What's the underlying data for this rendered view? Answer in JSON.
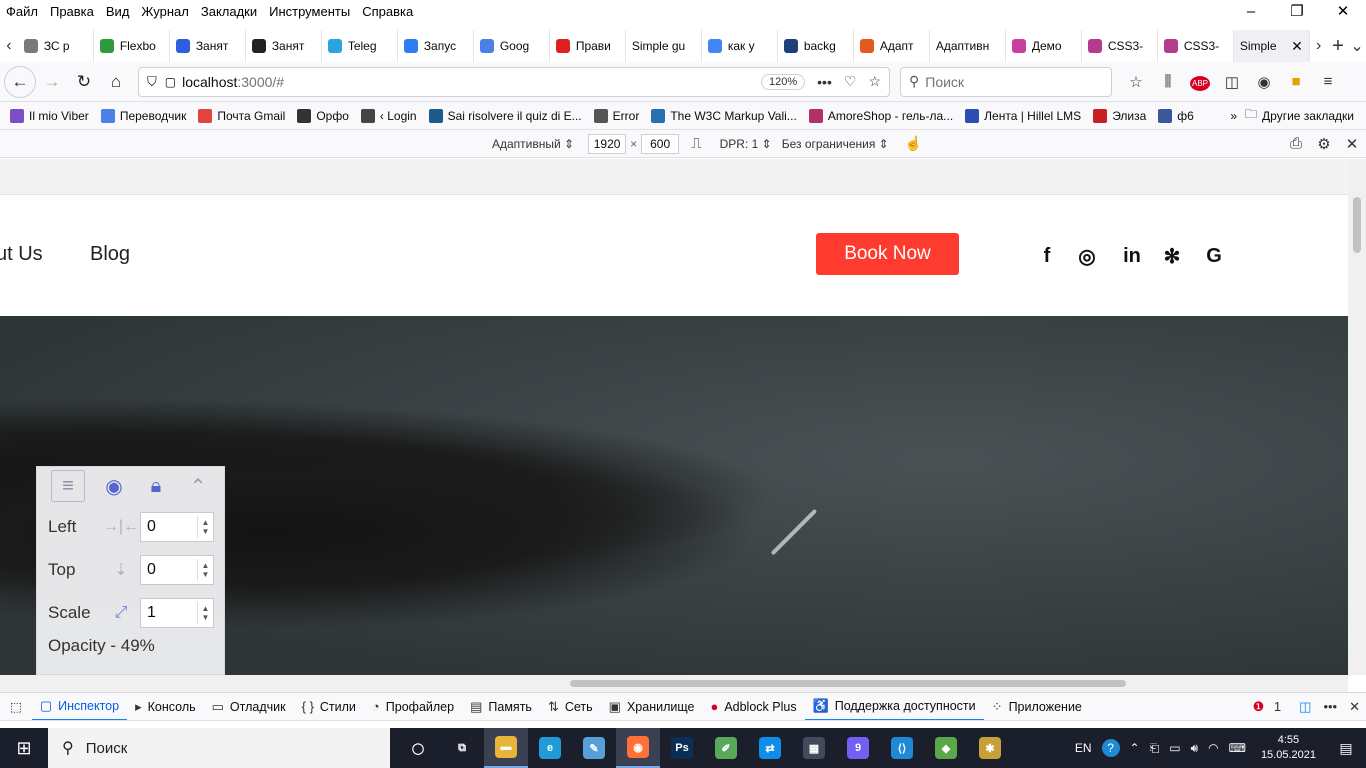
{
  "menubar": {
    "items": [
      "Файл",
      "Правка",
      "Вид",
      "Журнал",
      "Закладки",
      "Инструменты",
      "Справка"
    ]
  },
  "tabs": [
    {
      "label": "ЗС р",
      "color": "#7a7a7a"
    },
    {
      "label": "Flexbo",
      "color": "#2e9b3d"
    },
    {
      "label": "Занят",
      "color": "#2d5ee0"
    },
    {
      "label": "Занят",
      "color": "#222222"
    },
    {
      "label": "Teleg",
      "color": "#2aa3e0"
    },
    {
      "label": "Запус",
      "color": "#2d7cf6"
    },
    {
      "label": "Goog",
      "color": "#4a80e8"
    },
    {
      "label": "Прави",
      "color": "#e02020"
    },
    {
      "label": "Simple gu",
      "color": ""
    },
    {
      "label": "как у",
      "color": "#4285f4"
    },
    {
      "label": "backg",
      "color": "#1f3f7a"
    },
    {
      "label": "Адапт",
      "color": "#e25a1c"
    },
    {
      "label": "Адаптивн",
      "color": ""
    },
    {
      "label": "Демо",
      "color": "#c83fa0"
    },
    {
      "label": "CSS3-",
      "color": "#b33c8c"
    },
    {
      "label": "CSS3-",
      "color": "#b33c8c"
    },
    {
      "label": "Simple",
      "color": "",
      "active": true
    }
  ],
  "navbar": {
    "url_host": "localhost",
    "url_rest": ":3000/#",
    "zoom": "120%",
    "search_placeholder": "Поиск"
  },
  "bookmarks": [
    {
      "label": "Il mio Viber",
      "color": "#7a4fc8"
    },
    {
      "label": "Переводчик",
      "color": "#4a80e8"
    },
    {
      "label": "Почта Gmail",
      "color": "#e0443a"
    },
    {
      "label": "Орфо",
      "color": "#333333"
    },
    {
      "label": "‹ Login",
      "color": "#444444"
    },
    {
      "label": "Sai risolvere il quiz di E...",
      "color": "#1f5a8a"
    },
    {
      "label": "Error",
      "color": "#555555"
    },
    {
      "label": "The W3C Markup Vali...",
      "color": "#2a6fb0"
    },
    {
      "label": "AmoreShop - гель-ла...",
      "color": "#b0306a"
    },
    {
      "label": "Лента | Hillel LMS",
      "color": "#2a4fb0"
    },
    {
      "label": "Элиза",
      "color": "#c82020"
    },
    {
      "label": "ф6",
      "color": "#3b5998"
    }
  ],
  "bookmarks_more": "Другие закладки",
  "rdm": {
    "device": "Адаптивный",
    "width": "1920",
    "times": "×",
    "height": "600",
    "dpr": "DPR: 1",
    "throttle": "Без ограничения"
  },
  "site": {
    "nav_about": "ut Us",
    "nav_blog": "Blog",
    "book_label": "Book Now",
    "social": [
      "f",
      "◎",
      "in",
      "✻",
      "G"
    ]
  },
  "overlay": {
    "fields": [
      {
        "label": "Left",
        "value": "0"
      },
      {
        "label": "Top",
        "value": "0"
      },
      {
        "label": "Scale",
        "value": "1"
      }
    ],
    "opacity_text": "Opacity - 49%"
  },
  "devtools": {
    "tabs": [
      {
        "label": "Инспектор",
        "icon": "▢",
        "active": true
      },
      {
        "label": "Консоль",
        "icon": "▸"
      },
      {
        "label": "Отладчик",
        "icon": "▭"
      },
      {
        "label": "Стили",
        "icon": "{ }"
      },
      {
        "label": "Профайлер",
        "icon": "◔"
      },
      {
        "label": "Память",
        "icon": "▤"
      },
      {
        "label": "Сеть",
        "icon": "⇅"
      },
      {
        "label": "Хранилище",
        "icon": "▣"
      },
      {
        "label": "Adblock Plus",
        "icon": "●"
      },
      {
        "label": "Поддержка доступности",
        "icon": "♿",
        "selected": true
      },
      {
        "label": "Приложение",
        "icon": "⁘"
      }
    ],
    "error_count": "1"
  },
  "taskbar": {
    "search_text": "Поиск",
    "lang": "EN",
    "time": "4:55",
    "date": "15.05.2021",
    "apps": [
      {
        "name": "task-view",
        "glyph": "◯",
        "color": ""
      },
      {
        "name": "multitask",
        "glyph": "⧉",
        "color": ""
      },
      {
        "name": "explorer",
        "glyph": "▬",
        "color": "#e8b43a",
        "on": true
      },
      {
        "name": "edge",
        "glyph": "e",
        "color": "#1f9bd8"
      },
      {
        "name": "paint",
        "glyph": "✎",
        "color": "#5aa0d8"
      },
      {
        "name": "firefox",
        "glyph": "◉",
        "color": "#ff7139",
        "on": true
      },
      {
        "name": "photoshop",
        "glyph": "Ps",
        "color": "#0a2e54"
      },
      {
        "name": "notepad",
        "glyph": "✐",
        "color": "#5aa85a"
      },
      {
        "name": "teamviewer",
        "glyph": "⇄",
        "color": "#0e8ee9"
      },
      {
        "name": "calculator",
        "glyph": "▦",
        "color": "#444a5a"
      },
      {
        "name": "viber",
        "glyph": "9",
        "color": "#7360f2"
      },
      {
        "name": "vscode",
        "glyph": "⟨⟩",
        "color": "#1e8ad6"
      },
      {
        "name": "git",
        "glyph": "◆",
        "color": "#5aa84a"
      },
      {
        "name": "paint3d",
        "glyph": "✱",
        "color": "#c8a03a"
      }
    ]
  }
}
